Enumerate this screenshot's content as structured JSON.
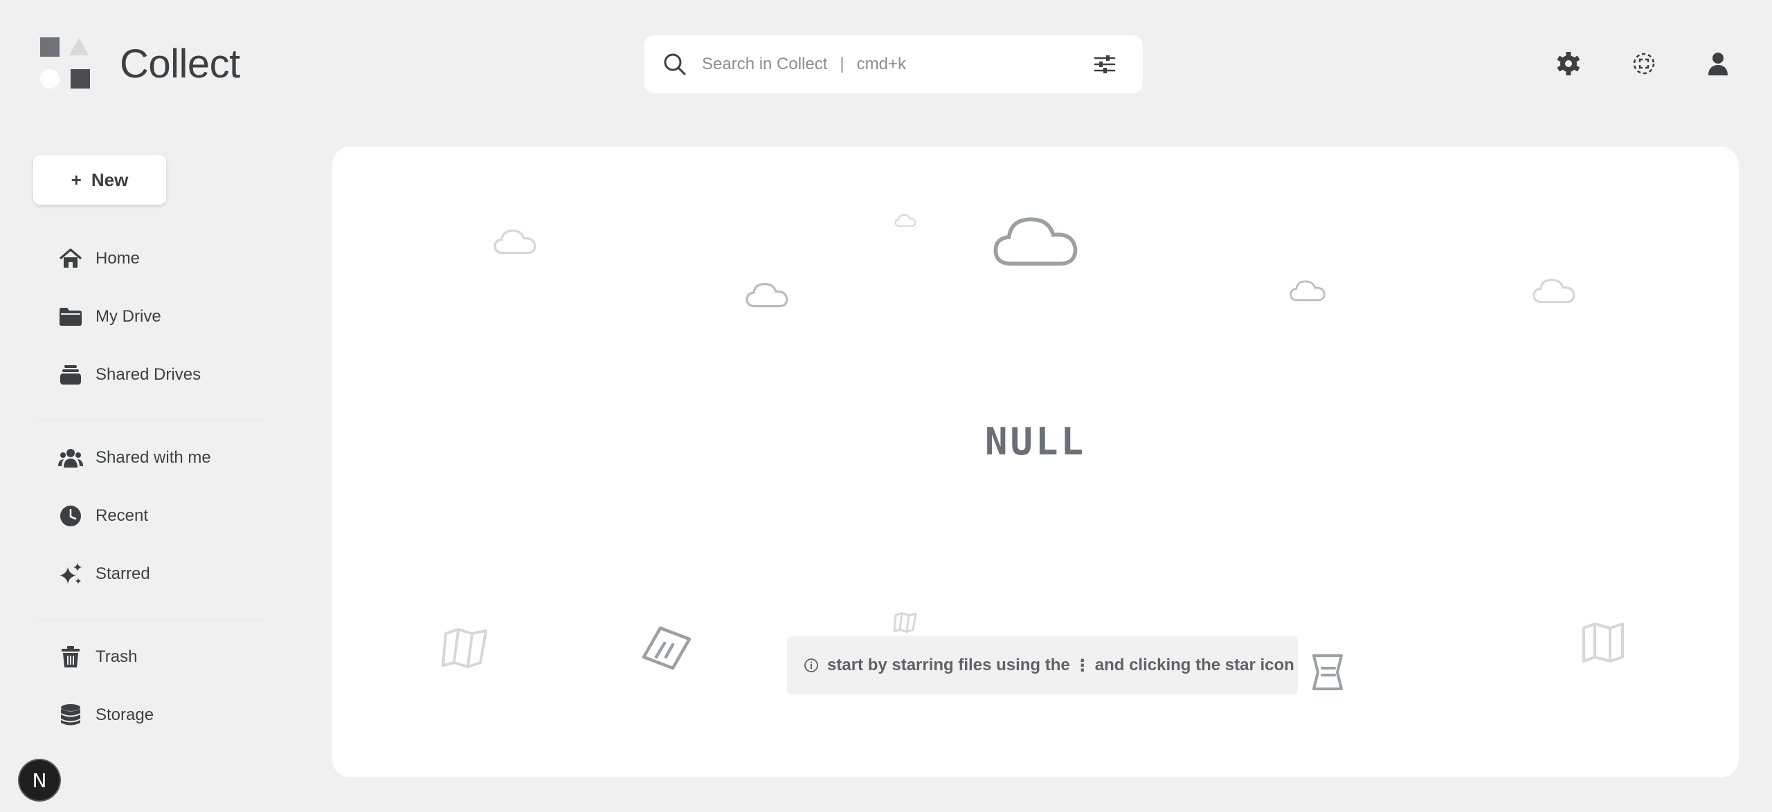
{
  "app": {
    "name": "Collect"
  },
  "search": {
    "placeholder": "Search in Collect",
    "separator": "|",
    "shortcut": "cmd+k"
  },
  "header": {
    "icons": [
      "settings-icon",
      "focus-icon",
      "account-icon"
    ]
  },
  "sidebar": {
    "new_button": {
      "plus": "+",
      "label": "New"
    },
    "items": [
      {
        "label": "Home",
        "icon": "home-icon"
      },
      {
        "label": "My Drive",
        "icon": "folder-icon"
      },
      {
        "label": "Shared Drives",
        "icon": "shared-drives-icon"
      },
      {
        "label": "Shared with me",
        "icon": "people-icon"
      },
      {
        "label": "Recent",
        "icon": "clock-icon"
      },
      {
        "label": "Starred",
        "icon": "sparkle-icon"
      },
      {
        "label": "Trash",
        "icon": "trash-icon"
      },
      {
        "label": "Storage",
        "icon": "database-icon"
      }
    ]
  },
  "badge": {
    "letter": "N"
  },
  "main": {
    "empty_title": "NULL",
    "hint": {
      "before": "start by starring files using the",
      "menu_glyph": "⋮",
      "after": "and clicking the star icon"
    }
  },
  "colors": {
    "background": "#f0f0f0",
    "panel": "#ffffff",
    "text": "#3c4043",
    "muted": "#8a8d91",
    "cloud_dark": "#9aa0a6",
    "cloud_light": "#d5d7da"
  }
}
